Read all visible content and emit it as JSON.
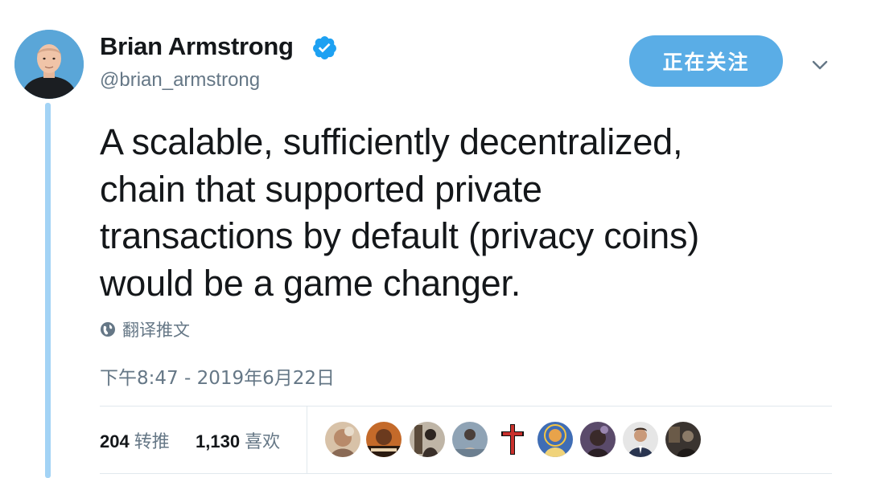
{
  "author": {
    "name": "Brian Armstrong",
    "handle": "@brian_armstrong",
    "verified": true
  },
  "follow_button": {
    "label": "正在关注"
  },
  "tweet": {
    "lines": [
      "A scalable, sufficiently decentralized,",
      "chain that supported private",
      "transactions by default (privacy coins)",
      "would be a game changer."
    ]
  },
  "translate": {
    "label": "翻译推文",
    "icon": "globe-icon"
  },
  "timestamp": "下午8:47 - 2019年6月22日",
  "stats": {
    "retweets_count": "204",
    "retweets_label": "转推",
    "likes_count": "1,130",
    "likes_label": "喜欢"
  },
  "colors": {
    "accent": "#5aade6",
    "thread_line": "#a3d3f5",
    "secondary_text": "#657786",
    "verified": "#1da1f2"
  }
}
